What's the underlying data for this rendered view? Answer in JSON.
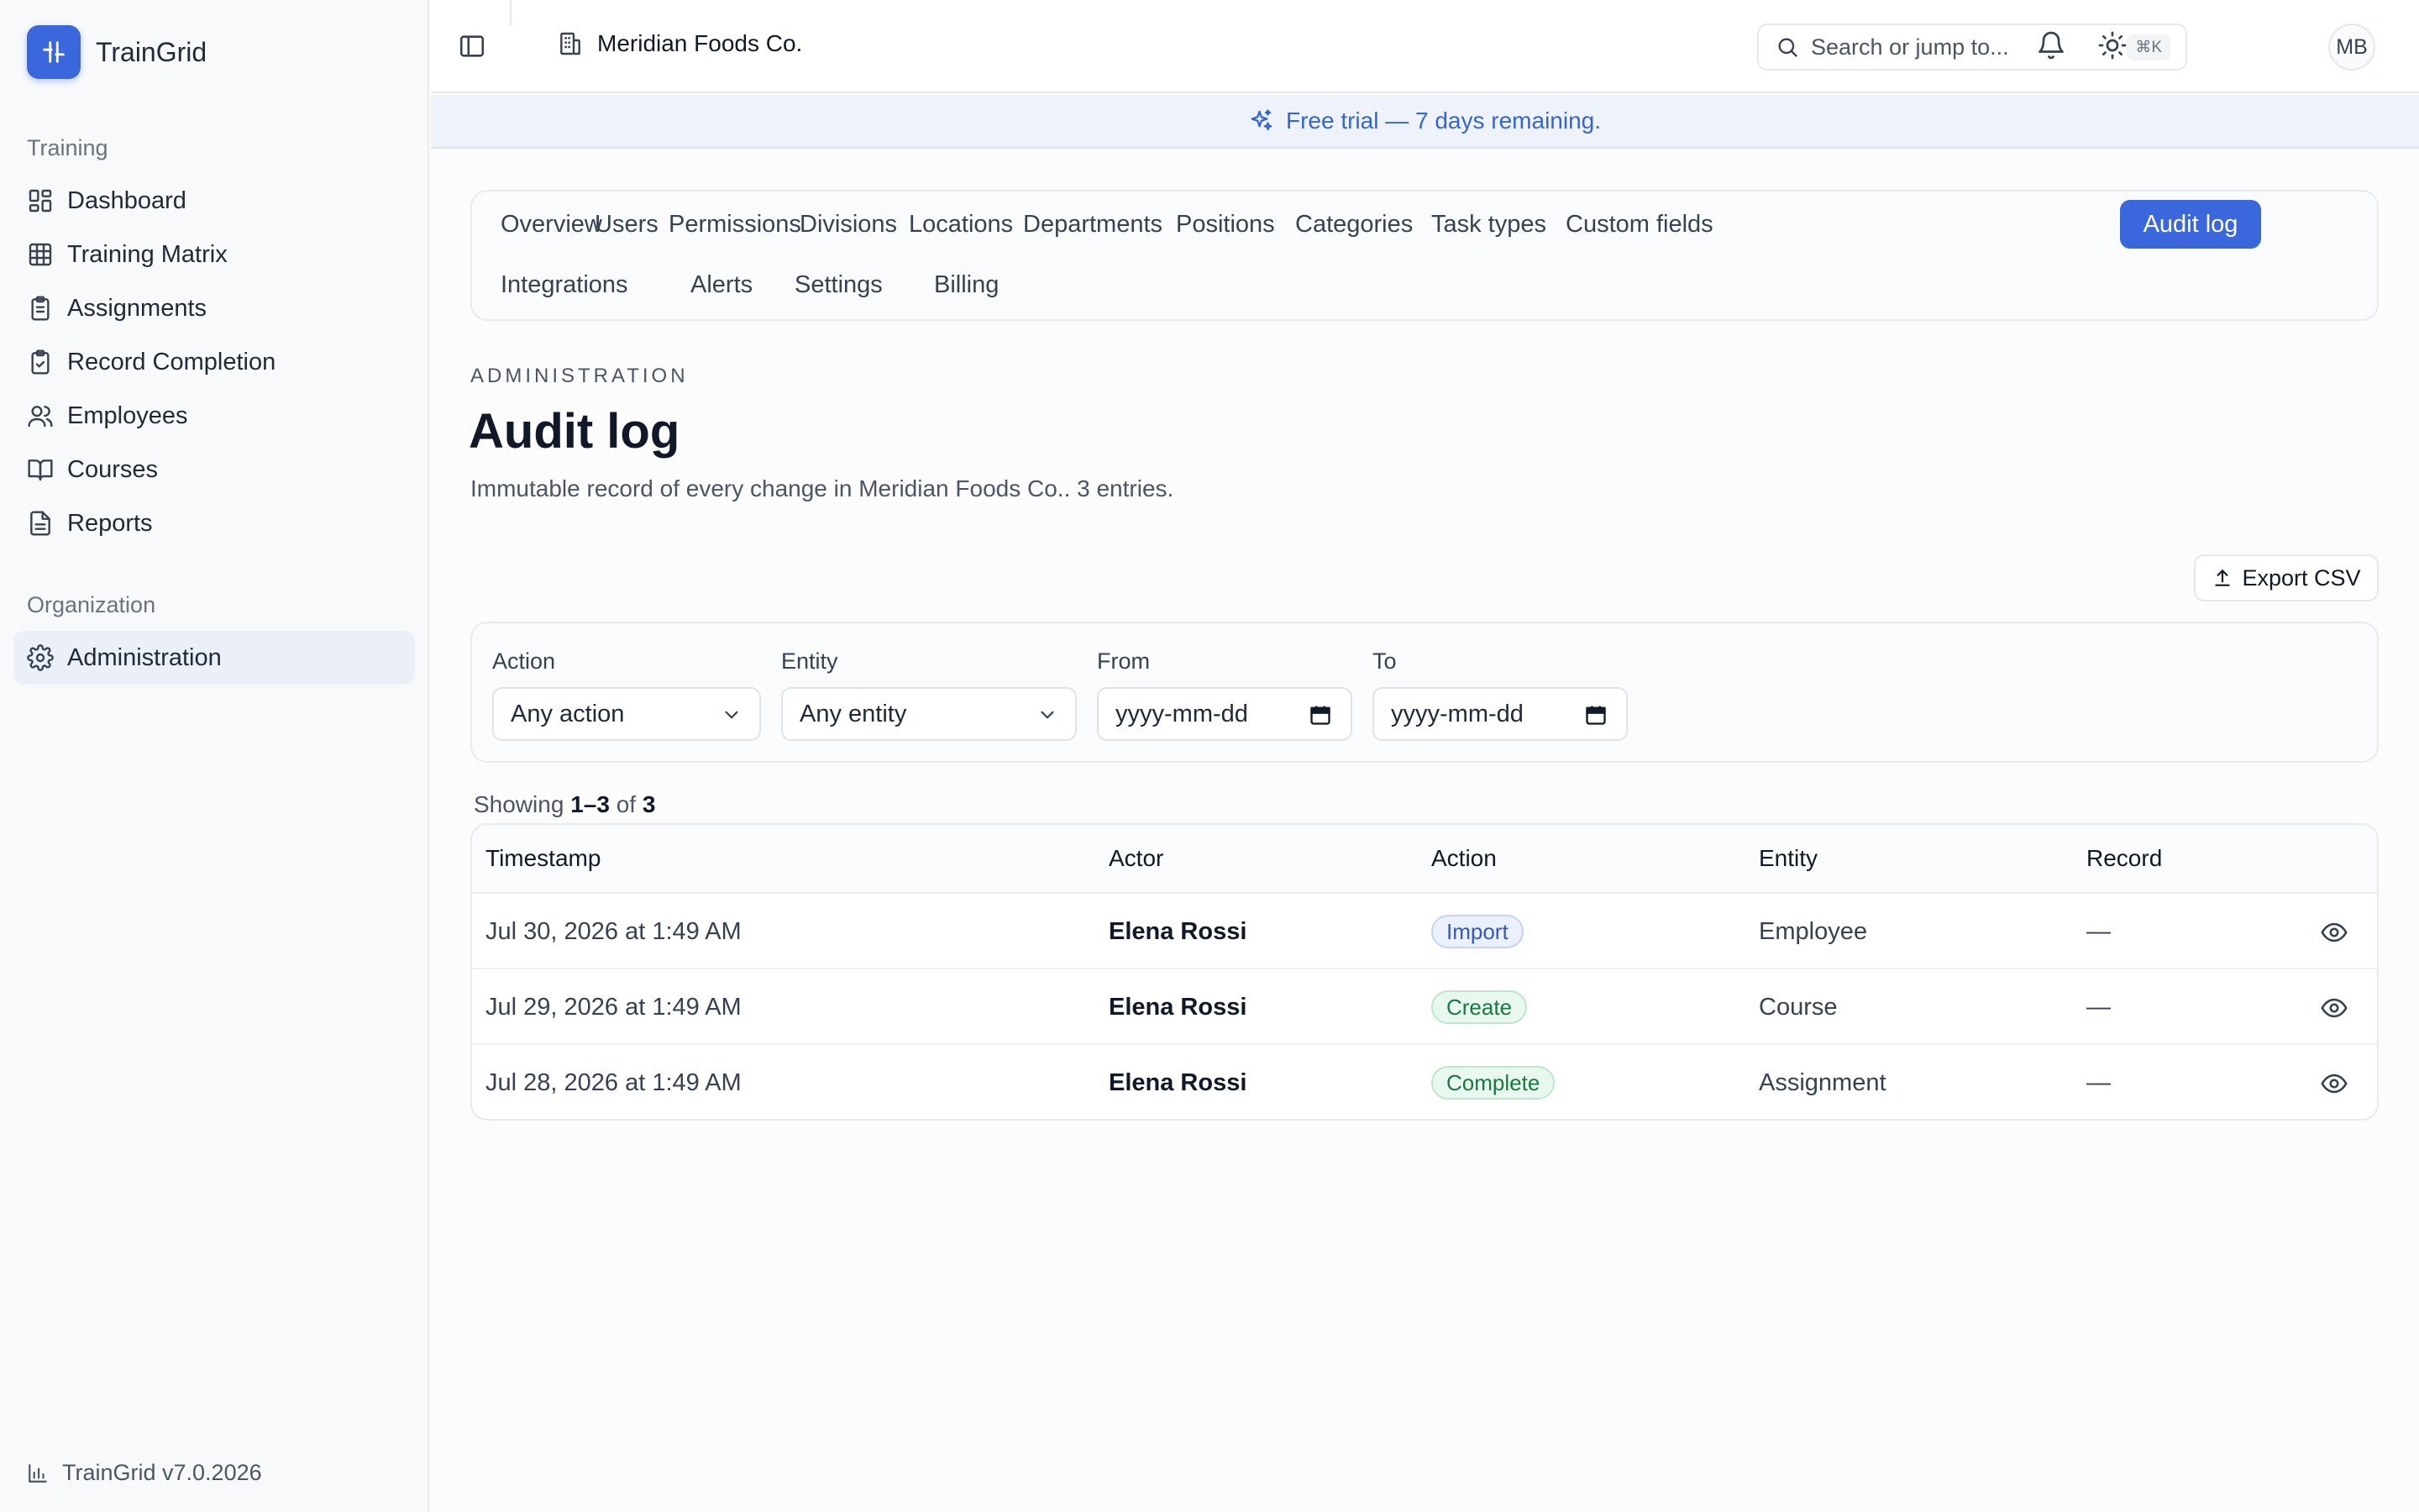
{
  "brand": {
    "name": "TrainGrid"
  },
  "sidebar": {
    "sections": [
      {
        "title": "Training"
      },
      {
        "title": "Organization"
      }
    ],
    "items": [
      {
        "label": "Dashboard",
        "icon": "dashboard-icon"
      },
      {
        "label": "Training Matrix",
        "icon": "grid-icon"
      },
      {
        "label": "Assignments",
        "icon": "clipboard-icon"
      },
      {
        "label": "Record Completion",
        "icon": "clipboard-check-icon"
      },
      {
        "label": "Employees",
        "icon": "users-icon"
      },
      {
        "label": "Courses",
        "icon": "book-icon"
      },
      {
        "label": "Reports",
        "icon": "file-text-icon"
      },
      {
        "label": "Administration",
        "icon": "gear-icon",
        "active": true
      }
    ],
    "version": "TrainGrid v7.0.2026"
  },
  "topbar": {
    "org_name": "Meridian Foods Co.",
    "search_placeholder": "Search or jump to...",
    "search_shortcut": "⌘K",
    "avatar_initials": "MB"
  },
  "trial_banner": {
    "text": "Free trial — 7 days remaining."
  },
  "tabs": [
    {
      "label": "Overview"
    },
    {
      "label": "Users"
    },
    {
      "label": "Permissions"
    },
    {
      "label": "Divisions"
    },
    {
      "label": "Locations"
    },
    {
      "label": "Departments"
    },
    {
      "label": "Positions"
    },
    {
      "label": "Categories"
    },
    {
      "label": "Task types"
    },
    {
      "label": "Custom fields"
    },
    {
      "label": "Audit log",
      "active": true
    },
    {
      "label": "Integrations"
    },
    {
      "label": "Alerts"
    },
    {
      "label": "Settings"
    },
    {
      "label": "Billing"
    }
  ],
  "header": {
    "eyebrow": "ADMINISTRATION",
    "title": "Audit log",
    "subtitle": "Immutable record of every change in Meridian Foods Co.. 3 entries."
  },
  "export_label": "Export CSV",
  "filters": {
    "action": {
      "label": "Action",
      "value": "Any action"
    },
    "entity": {
      "label": "Entity",
      "value": "Any entity"
    },
    "from": {
      "label": "From",
      "placeholder": "yyyy-mm-dd"
    },
    "to": {
      "label": "To",
      "placeholder": "yyyy-mm-dd"
    }
  },
  "showing": {
    "prefix": "Showing",
    "range": "1–3",
    "of": "of",
    "total": "3"
  },
  "table": {
    "columns": [
      "Timestamp",
      "Actor",
      "Action",
      "Entity",
      "Record"
    ],
    "rows": [
      {
        "timestamp": "Jul 30, 2026 at 1:49 AM",
        "actor": "Elena Rossi",
        "action": "Import",
        "action_color": "#3358c4",
        "entity": "Employee",
        "record": "—"
      },
      {
        "timestamp": "Jul 29, 2026 at 1:49 AM",
        "actor": "Elena Rossi",
        "action": "Create",
        "action_color": "#177a42",
        "entity": "Course",
        "record": "—"
      },
      {
        "timestamp": "Jul 28, 2026 at 1:49 AM",
        "actor": "Elena Rossi",
        "action": "Complete",
        "action_color": "#177a42",
        "entity": "Assignment",
        "record": "—"
      }
    ]
  },
  "colors": {
    "accent": "#3b67dc",
    "trial_text": "#3565d4"
  }
}
